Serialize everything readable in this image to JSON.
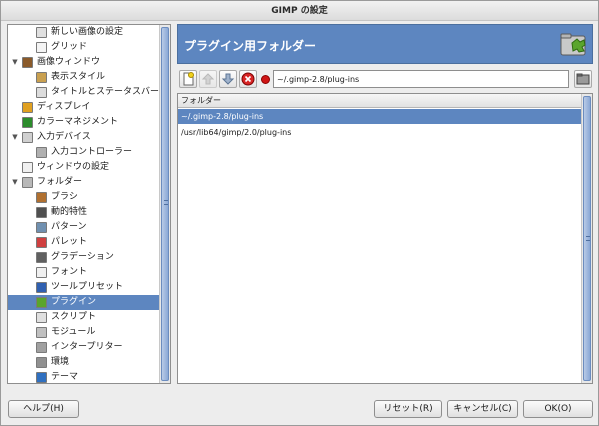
{
  "window": {
    "title": "GIMP の設定"
  },
  "sidebar": {
    "items": [
      {
        "label": "新しい画像の設定",
        "level": 1,
        "icon": "new-image-icon",
        "expander": ""
      },
      {
        "label": "グリッド",
        "level": 1,
        "icon": "grid-icon",
        "expander": ""
      },
      {
        "label": "画像ウィンドウ",
        "level": 0,
        "icon": "image-window-icon",
        "expander": "▼"
      },
      {
        "label": "表示スタイル",
        "level": 1,
        "icon": "appearance-icon",
        "expander": ""
      },
      {
        "label": "タイトルとステータスバー",
        "level": 1,
        "icon": "title-status-icon",
        "expander": ""
      },
      {
        "label": "ディスプレイ",
        "level": 0,
        "icon": "display-icon",
        "expander": ""
      },
      {
        "label": "カラーマネジメント",
        "level": 0,
        "icon": "color-management-icon",
        "expander": ""
      },
      {
        "label": "入力デバイス",
        "level": 0,
        "icon": "input-devices-icon",
        "expander": "▼"
      },
      {
        "label": "入力コントローラー",
        "level": 1,
        "icon": "input-controllers-icon",
        "expander": ""
      },
      {
        "label": "ウィンドウの設定",
        "level": 0,
        "icon": "window-management-icon",
        "expander": ""
      },
      {
        "label": "フォルダー",
        "level": 0,
        "icon": "folders-icon",
        "expander": "▼"
      },
      {
        "label": "ブラシ",
        "level": 1,
        "icon": "brush-icon",
        "expander": ""
      },
      {
        "label": "動的特性",
        "level": 1,
        "icon": "dynamics-icon",
        "expander": ""
      },
      {
        "label": "パターン",
        "level": 1,
        "icon": "pattern-icon",
        "expander": ""
      },
      {
        "label": "パレット",
        "level": 1,
        "icon": "palette-icon",
        "expander": ""
      },
      {
        "label": "グラデーション",
        "level": 1,
        "icon": "gradient-icon",
        "expander": ""
      },
      {
        "label": "フォント",
        "level": 1,
        "icon": "font-icon",
        "expander": ""
      },
      {
        "label": "ツールプリセット",
        "level": 1,
        "icon": "tool-preset-icon",
        "expander": ""
      },
      {
        "label": "プラグイン",
        "level": 1,
        "icon": "plugin-icon",
        "expander": "",
        "selected": true
      },
      {
        "label": "スクリプト",
        "level": 1,
        "icon": "script-icon",
        "expander": ""
      },
      {
        "label": "モジュール",
        "level": 1,
        "icon": "module-icon",
        "expander": ""
      },
      {
        "label": "インタープリター",
        "level": 1,
        "icon": "interpreter-icon",
        "expander": ""
      },
      {
        "label": "環境",
        "level": 1,
        "icon": "environment-icon",
        "expander": ""
      },
      {
        "label": "テーマ",
        "level": 1,
        "icon": "theme-icon",
        "expander": ""
      }
    ]
  },
  "page": {
    "title": "プラグイン用フォルダー",
    "icon": "plugin-folder-icon",
    "accent": "#5d86c0"
  },
  "toolbar": {
    "path_value": "~/.gimp-2.8/plug-ins",
    "buttons": [
      "new-folder-icon",
      "move-up-icon",
      "move-down-icon",
      "delete-icon"
    ],
    "browse_icon": "browse-folder-icon"
  },
  "folders": {
    "header": "フォルダー",
    "rows": [
      {
        "path": "~/.gimp-2.8/plug-ins",
        "selected": true
      },
      {
        "path": "/usr/lib64/gimp/2.0/plug-ins",
        "selected": false
      }
    ]
  },
  "buttons": {
    "help": "ヘルプ(H)",
    "reset": "リセット(R)",
    "cancel": "キャンセル(C)",
    "ok": "OK(O)"
  }
}
